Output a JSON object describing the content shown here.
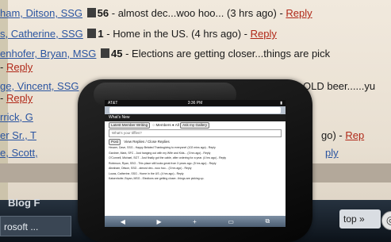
{
  "background": {
    "feed": [
      {
        "name": "ham, Ditson, SSG",
        "count": "56",
        "text": " - almost dec...woo hoo... (3 hrs ago) - ",
        "reply": "Reply"
      },
      {
        "name": "s, Catherine, SSG",
        "count": "1",
        "text": " - Home in the US. (4 hrs ago) - ",
        "reply": "Reply"
      },
      {
        "name": "enhofer, Bryan, MSG",
        "count": "45",
        "text": " - Elections are getting closer...things are pick",
        "reply": ""
      },
      {
        "name": "",
        "count": "",
        "text": " - ",
        "reply": "Reply"
      },
      {
        "name": "ge, Vincent, SSG",
        "count": "",
        "text": "",
        "reply": ""
      },
      {
        "name": "",
        "count": "",
        "text": " - ",
        "reply": "Reply"
      },
      {
        "name": "rrick, G",
        "count": "",
        "text": "",
        "reply": ""
      },
      {
        "name": "er Sr., T",
        "count": "",
        "text": "",
        "reply": ""
      },
      {
        "name": "e, Scott,",
        "count": "",
        "text": "",
        "reply": ""
      }
    ],
    "partial_right": [
      {
        "text": "OLD beer......yu"
      },
      {
        "text": "go) - ",
        "reply": "Rep"
      },
      {
        "text": "",
        "reply": "ply"
      }
    ],
    "blog_heading": "Blog F",
    "taskbar_item": "rosoft ...",
    "stop_label": "top",
    "stop_arrow": "»"
  },
  "phone": {
    "status_left": "AT&T",
    "status_time": "3:36 PM",
    "whats_new_title": "What's New",
    "controls": [
      "Latest Member Writing",
      "Members",
      "All",
      "Ask my Gallery"
    ],
    "ask_placeholder": "What's your tiffles?",
    "poll_buttons": [
      "Post",
      "View Replies",
      "Close Replies"
    ],
    "feed_lines": [
      "Heazer, Dave, SSG - Happy Belated Thanksgiving to everyone! (102 mins ago) - Reply",
      "Gardner, Mark, SFC - Just hanging out with my Wife and Kids... (3 hrs ago) - Reply",
      "O'Connell, Michael, SGT - Just finally got the cable, after ordering for a year. (4 hrs ago) - Reply",
      "Robinson, Ryan, SSG - This place still looks great from 3 years ago. (5 hrs ago) - Reply",
      "Abraham, Ditson, SSG - almost dec...woo hoo... (3 hrs ago) - Reply",
      "Lucas, Catherine, SSG - Home in the US. (4 hrs ago) - Reply",
      "Kaisenhofer, Bryan, MSG - Elections are getting closer...things are picking up."
    ],
    "toolbar_icons": [
      "back-icon",
      "forward-icon",
      "add-icon",
      "bookmarks-icon",
      "pages-icon"
    ]
  }
}
